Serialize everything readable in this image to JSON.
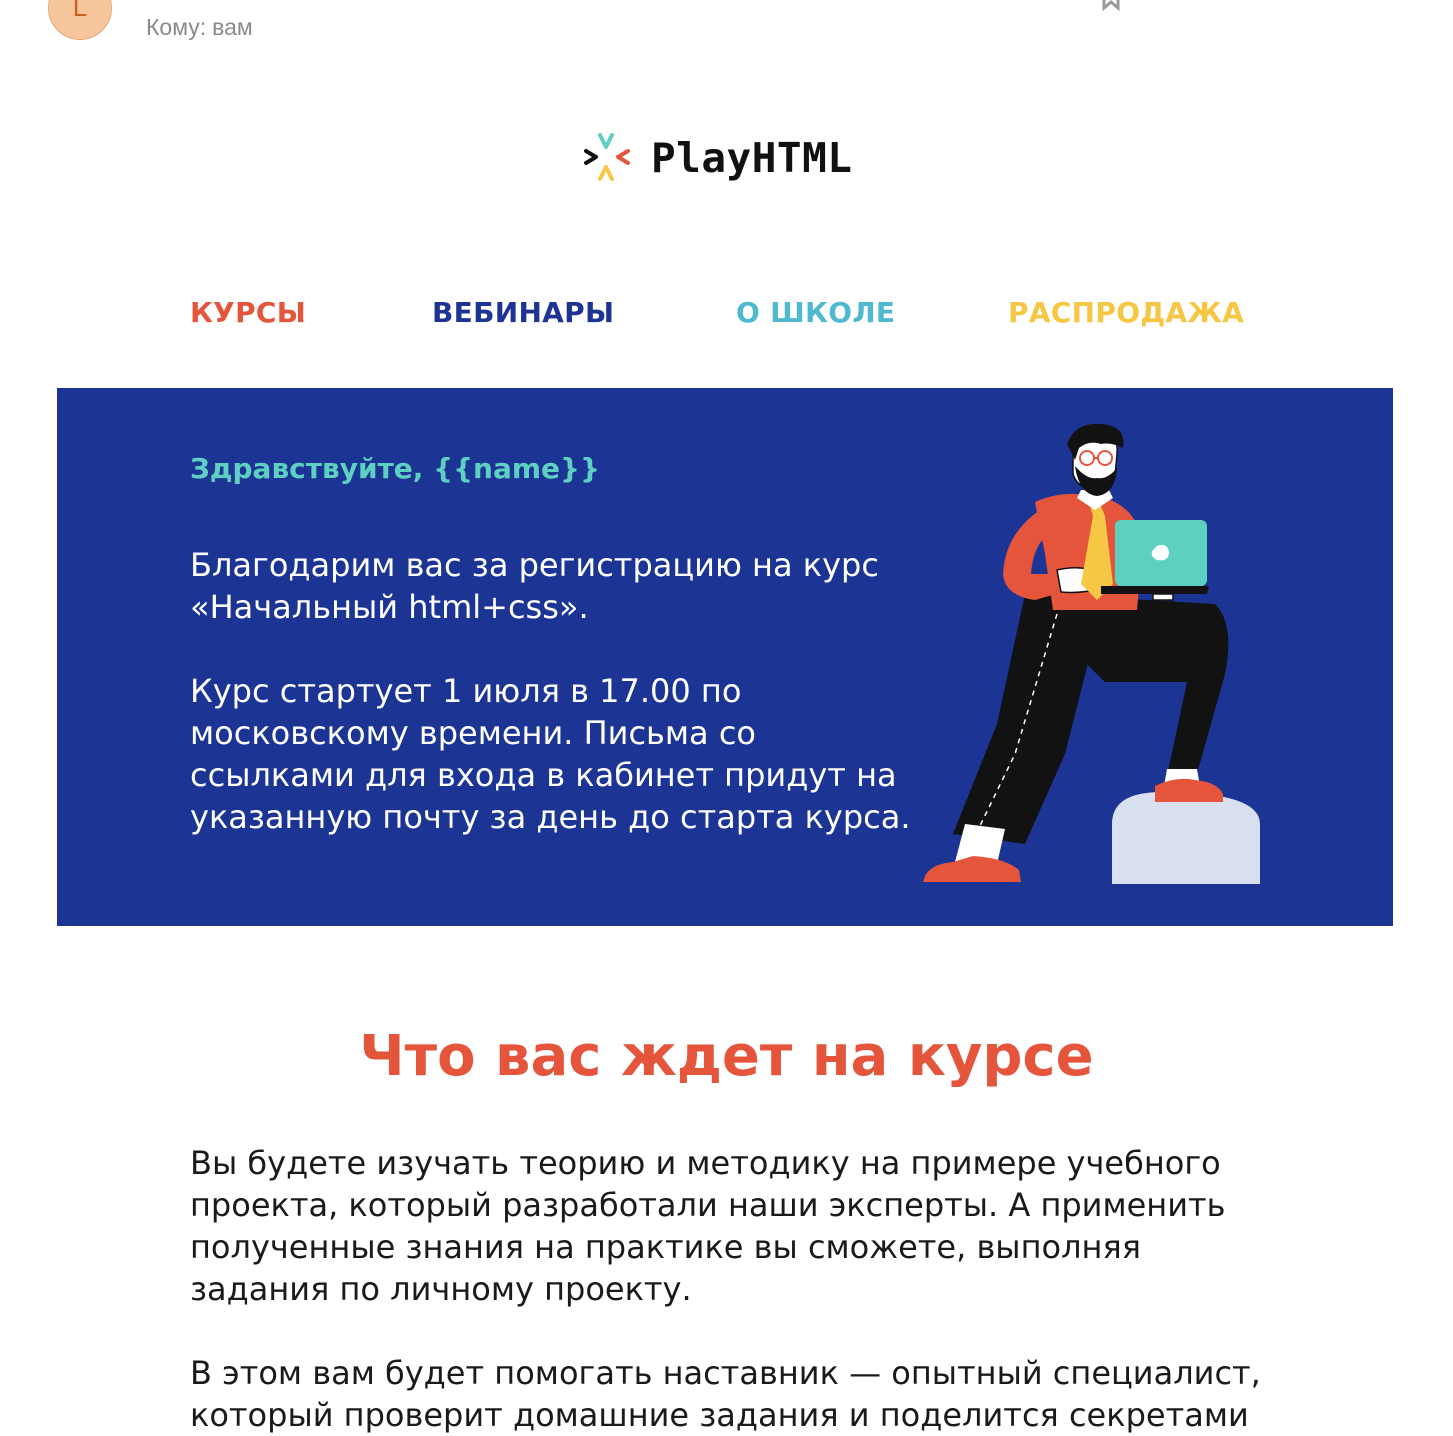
{
  "mail": {
    "avatar_letter": "L",
    "to_label": "Кому:",
    "to_value": "вам",
    "icons": [
      "bookmark-icon",
      "video-icon",
      "window-icon",
      "print-icon"
    ]
  },
  "logo": {
    "text": "PlayHTML",
    "colors": {
      "teal": "#5dd0c2",
      "red": "#e5553c",
      "yellow": "#f5c745",
      "black": "#111111"
    }
  },
  "nav": {
    "items": [
      {
        "label": "КУРСЫ",
        "color": "#e5553c"
      },
      {
        "label": "ВЕБИНАРЫ",
        "color": "#1e3494"
      },
      {
        "label": "О ШКОЛЕ",
        "color": "#4fb9cf"
      },
      {
        "label": "РАСПРОДАЖА",
        "color": "#f5c745"
      }
    ]
  },
  "hero": {
    "background": "#1c3595",
    "greeting": "Здравствуйте, {{name}}",
    "paragraph1": "Благодарим вас за регистрацию на курс «Начальный html+css».",
    "paragraph2": "Курс стартует 1 июля в 17.00 по московскому времени. Письма со ссылками для входа в кабинет придут на указанную почту за день до старта курса."
  },
  "section": {
    "title": "Что вас ждет на курсе",
    "paragraph1": "Вы будете изучать теорию и методику на примере учебного проекта, который разработали наши эксперты. А применить полученные знания на практике вы сможете, выполняя задания по личному проекту.",
    "paragraph2": "В этом вам будет помогать наставник — опытный специалист, который проверит домашние задания и поделится секретами"
  }
}
